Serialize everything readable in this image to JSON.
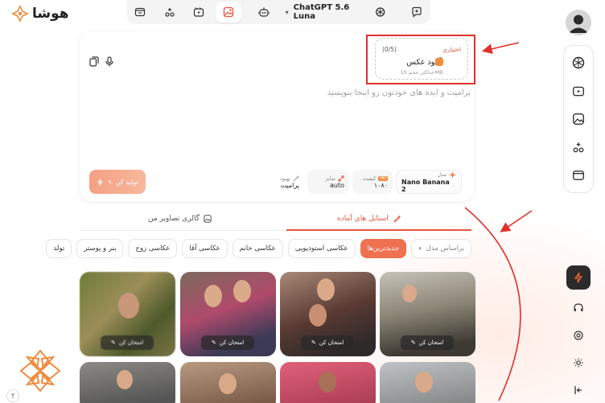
{
  "brand": {
    "logo_text": "هوشا"
  },
  "topnav": {
    "model_name": "ChatGPT 5.6 Luna",
    "icons": [
      "folder-icon",
      "nodes-icon",
      "video-icon",
      "image-icon",
      "robot-icon"
    ]
  },
  "upload": {
    "count": "(0/5)",
    "optional": "اختیاری",
    "title": "آپلود عکس",
    "max_size": "حداکثر حجم 10MB"
  },
  "prompt": {
    "placeholder": "پرامپت و ایده های خودتون رو اینجا بنویسید"
  },
  "options": {
    "model_label": "مدل",
    "model_value": "Nano Banana 2",
    "quality_label": "کیفیت",
    "quality_value": "۱۰۸۰",
    "size_label": "سایز",
    "size_value": "auto",
    "improve_label": "بهبود",
    "improve_value": "پرامپت"
  },
  "generate": {
    "label": "تولید کن",
    "cost": "۹"
  },
  "tabs": {
    "styles": "استایل های آماده",
    "gallery": "گالری تصاویر من"
  },
  "chips": {
    "sort": "براساس مدل",
    "items": [
      "جدیدترین‌ها",
      "عکاسی استودیویی",
      "عکاسی خانم",
      "عکاسی آقا",
      "عکاسی زوج",
      "بنر و پوستر",
      "تولد"
    ]
  },
  "cards": {
    "try_label": "امتحان کن"
  },
  "accent": "#e8543a",
  "annotation_color": "#e0322b"
}
